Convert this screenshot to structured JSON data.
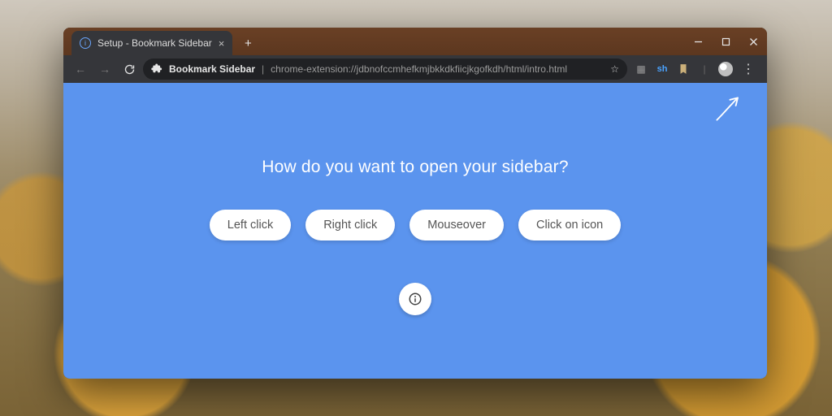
{
  "window": {
    "tab_title": "Setup - Bookmark Sidebar"
  },
  "toolbar": {
    "extension_name": "Bookmark Sidebar",
    "url": "chrome-extension://jdbnofccmhefkmjbkkdkfiicjkgofkdh/html/intro.html"
  },
  "page": {
    "heading": "How do you want to open your sidebar?",
    "options": [
      "Left click",
      "Right click",
      "Mouseover",
      "Click on icon"
    ]
  }
}
